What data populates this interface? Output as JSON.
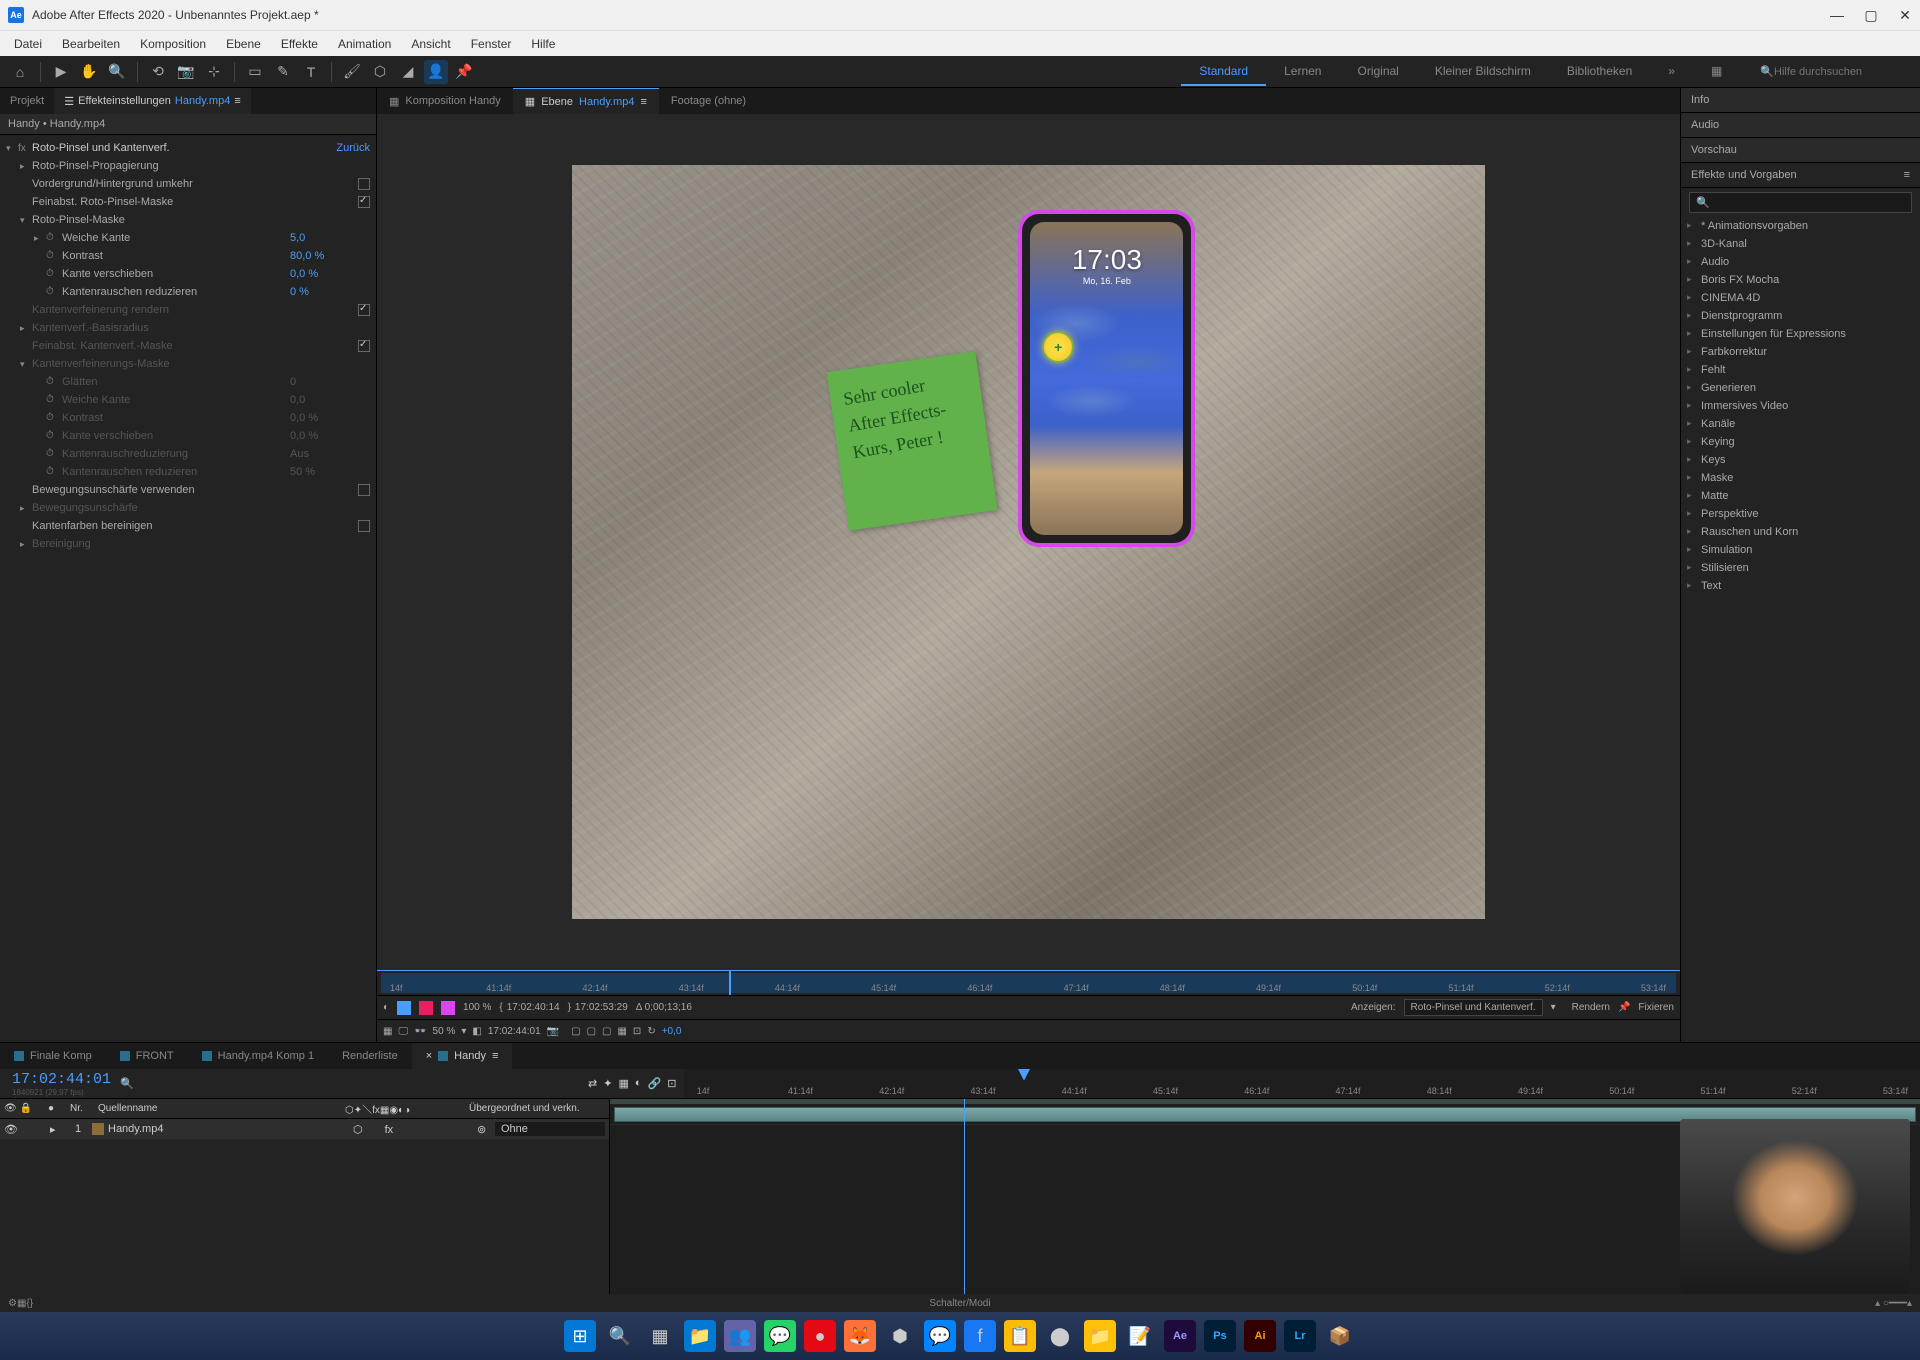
{
  "titlebar": {
    "app_icon": "Ae",
    "title": "Adobe After Effects 2020 - Unbenanntes Projekt.aep *"
  },
  "menubar": [
    "Datei",
    "Bearbeiten",
    "Komposition",
    "Ebene",
    "Effekte",
    "Animation",
    "Ansicht",
    "Fenster",
    "Hilfe"
  ],
  "workspaces": {
    "items": [
      "Standard",
      "Lernen",
      "Original",
      "Kleiner Bildschirm",
      "Bibliotheken"
    ],
    "active": "Standard",
    "search_placeholder": "Hilfe durchsuchen"
  },
  "left_panel": {
    "tabs": [
      {
        "label": "Projekt",
        "active": false
      },
      {
        "label_prefix": "Effekteinstellungen ",
        "label_highlight": "Handy.mp4",
        "active": true
      }
    ],
    "breadcrumb": "Handy • Handy.mp4",
    "effect": {
      "name": "Roto-Pinsel und Kantenverf.",
      "reset": "Zurück"
    },
    "rows": [
      {
        "indent": 1,
        "expand": "▸",
        "label": "Roto-Pinsel-Propagierung"
      },
      {
        "indent": 1,
        "label": "Vordergrund/Hintergrund umkehr",
        "checkbox": false
      },
      {
        "indent": 1,
        "label": "Feinabst. Roto-Pinsel-Maske",
        "checkbox": true
      },
      {
        "indent": 1,
        "expand": "▾",
        "label": "Roto-Pinsel-Maske"
      },
      {
        "indent": 2,
        "expand": "▸",
        "stopwatch": true,
        "label": "Weiche Kante",
        "value": "5,0"
      },
      {
        "indent": 2,
        "stopwatch": true,
        "label": "Kontrast",
        "value": "80,0 %"
      },
      {
        "indent": 2,
        "stopwatch": true,
        "label": "Kante verschieben",
        "value": "0,0 %"
      },
      {
        "indent": 2,
        "stopwatch": true,
        "label": "Kantenrauschen reduzieren",
        "value": "0 %"
      },
      {
        "indent": 1,
        "label": "Kantenverfeinerung rendern",
        "checkbox": true,
        "dim": true
      },
      {
        "indent": 1,
        "expand": "▸",
        "label": "Kantenverf.-Basisradius",
        "dim": true
      },
      {
        "indent": 1,
        "label": "Feinabst. Kantenverf.-Maske",
        "checkbox": true,
        "dim": true
      },
      {
        "indent": 1,
        "expand": "▾",
        "label": "Kantenverfeinerungs-Maske",
        "dim": true
      },
      {
        "indent": 2,
        "stopwatch": true,
        "label": "Glätten",
        "value": "0",
        "dim": true
      },
      {
        "indent": 2,
        "stopwatch": true,
        "label": "Weiche Kante",
        "value": "0,0",
        "dim": true
      },
      {
        "indent": 2,
        "stopwatch": true,
        "label": "Kontrast",
        "value": "0,0 %",
        "dim": true
      },
      {
        "indent": 2,
        "stopwatch": true,
        "label": "Kante verschieben",
        "value": "0,0 %",
        "dim": true
      },
      {
        "indent": 2,
        "stopwatch": true,
        "label": "Kantenrauschreduzierung",
        "value": "Aus",
        "dim": true
      },
      {
        "indent": 2,
        "stopwatch": true,
        "label": "Kantenrauschen reduzieren",
        "value": "50 %",
        "dim": true
      },
      {
        "indent": 1,
        "label": "Bewegungsunschärfe verwenden",
        "checkbox": false
      },
      {
        "indent": 1,
        "expand": "▸",
        "label": "Bewegungsunschärfe",
        "dim": true
      },
      {
        "indent": 1,
        "label": "Kantenfarben bereinigen",
        "checkbox": false
      },
      {
        "indent": 1,
        "expand": "▸",
        "label": "Bereinigung",
        "dim": true
      }
    ]
  },
  "viewer": {
    "tabs": [
      {
        "label": "Komposition Handy",
        "active": false
      },
      {
        "label_prefix": "Ebene ",
        "label_highlight": "Handy.mp4",
        "active": true
      },
      {
        "label": "Footage  (ohne)",
        "active": false
      }
    ],
    "phone_time": "17:03",
    "phone_date": "Mo, 16. Feb",
    "note_text": "Sehr cooler After Effects-Kurs, Peter !",
    "mini_ticks": [
      "14f",
      "41:14f",
      "42:14f",
      "43:14f",
      "44:14f",
      "45:14f",
      "46:14f",
      "47:14f",
      "48:14f",
      "49:14f",
      "50:14f",
      "51:14f",
      "52:14f",
      "53:14f"
    ],
    "ctrl1": {
      "percent": "100 %",
      "time1": "17:02:40:14",
      "time2": "17:02:53:29",
      "duration": "Δ 0;00;13;16",
      "show_label": "Anzeigen:",
      "show_value": "Roto-Pinsel und Kantenverf.",
      "render_label": "Rendern",
      "fix_label": "Fixieren"
    },
    "ctrl2": {
      "zoom": "50 %",
      "time": "17:02:44:01",
      "offset": "+0,0"
    }
  },
  "right_panel": {
    "sections": [
      "Info",
      "Audio",
      "Vorschau"
    ],
    "effects_title": "Effekte und Vorgaben",
    "categories": [
      "* Animationsvorgaben",
      "3D-Kanal",
      "Audio",
      "Boris FX Mocha",
      "CINEMA 4D",
      "Dienstprogramm",
      "Einstellungen für Expressions",
      "Farbkorrektur",
      "Fehlt",
      "Generieren",
      "Immersives Video",
      "Kanäle",
      "Keying",
      "Keys",
      "Maske",
      "Matte",
      "Perspektive",
      "Rauschen und Korn",
      "Simulation",
      "Stilisieren",
      "Text"
    ]
  },
  "timeline": {
    "tabs": [
      {
        "label": "Finale Komp"
      },
      {
        "label": "FRONT"
      },
      {
        "label": "Handy.mp4 Komp 1"
      },
      {
        "label": "Renderliste",
        "no_swatch": true
      },
      {
        "label": "Handy",
        "active": true
      }
    ],
    "timecode": "17:02:44:01",
    "subtime": "1840921 (29,97 fps)",
    "ticks": [
      "14f",
      "41:14f",
      "42:14f",
      "43:14f",
      "44:14f",
      "45:14f",
      "46:14f",
      "47:14f",
      "48:14f",
      "49:14f",
      "50:14f",
      "51:14f",
      "52:14f",
      "53:14f"
    ],
    "columns": {
      "nr": "Nr.",
      "source": "Quellenname",
      "parent": "Übergeordnet und verkn."
    },
    "layer": {
      "num": "1",
      "name": "Handy.mp4",
      "parent": "Ohne"
    },
    "status": "Schalter/Modi"
  }
}
